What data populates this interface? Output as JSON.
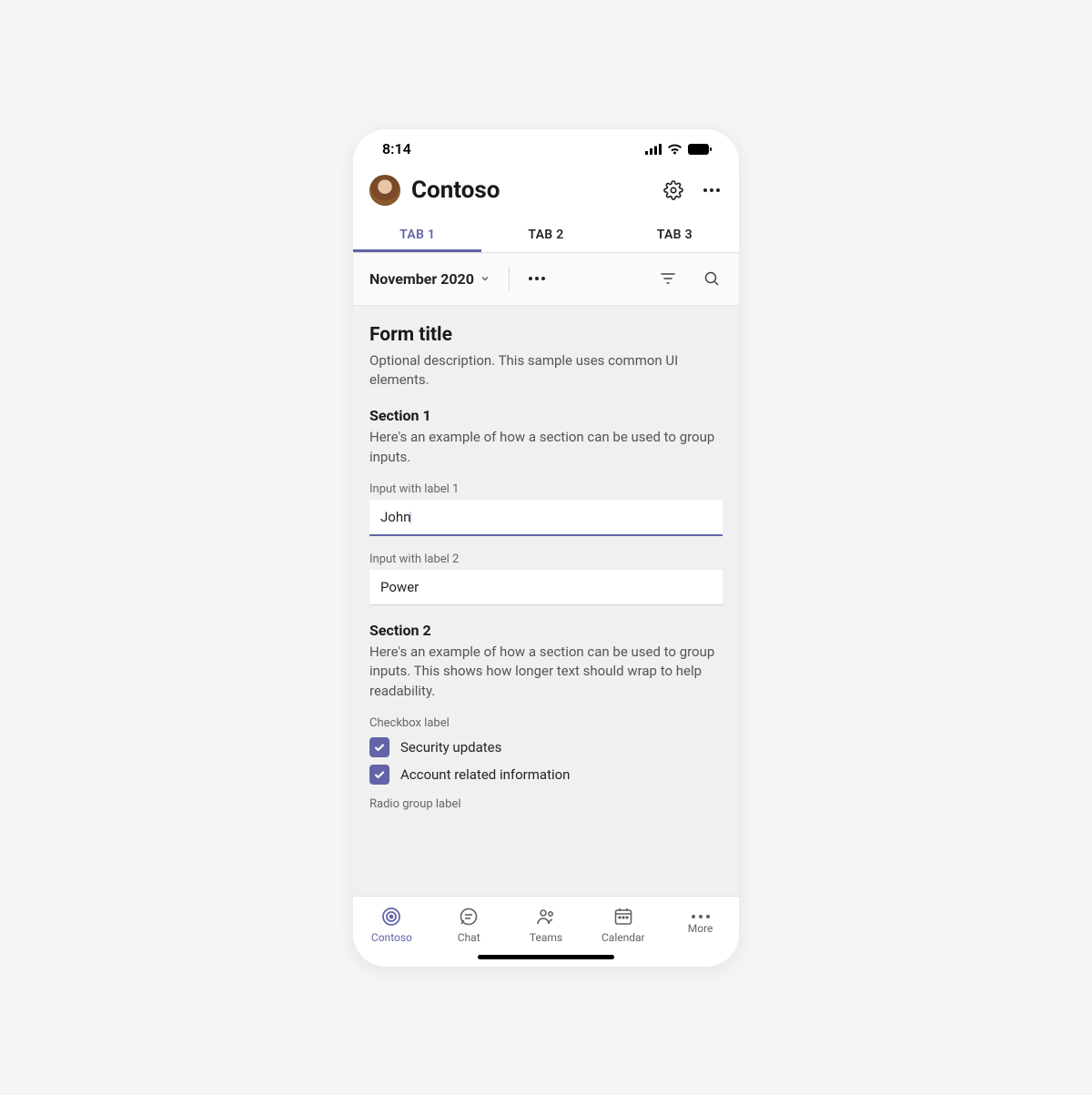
{
  "status": {
    "time": "8:14"
  },
  "header": {
    "title": "Contoso"
  },
  "tabs": [
    "TAB 1",
    "TAB 2",
    "TAB 3"
  ],
  "active_tab_index": 0,
  "subtoolbar": {
    "month": "November 2020"
  },
  "form": {
    "title": "Form title",
    "description": "Optional description. This sample uses common UI elements.",
    "sections": [
      {
        "title": "Section 1",
        "description": "Here's an example of how a section can be used to group inputs.",
        "inputs": [
          {
            "label": "Input with label 1",
            "value": "John",
            "focused": true
          },
          {
            "label": "Input with label 2",
            "value": "Power",
            "focused": false
          }
        ]
      },
      {
        "title": "Section 2",
        "description": "Here's an example of how a section can be used to group inputs. This shows how longer text should wrap to help readability.",
        "checkbox_group": {
          "label": "Checkbox label",
          "items": [
            {
              "label": "Security updates",
              "checked": true
            },
            {
              "label": "Account related information",
              "checked": true
            }
          ]
        },
        "radio_group": {
          "label": "Radio group label"
        }
      }
    ]
  },
  "bottom_nav": [
    {
      "label": "Contoso",
      "active": true
    },
    {
      "label": "Chat",
      "active": false
    },
    {
      "label": "Teams",
      "active": false
    },
    {
      "label": "Calendar",
      "active": false
    },
    {
      "label": "More",
      "active": false
    }
  ],
  "colors": {
    "accent": "#6264A7"
  }
}
